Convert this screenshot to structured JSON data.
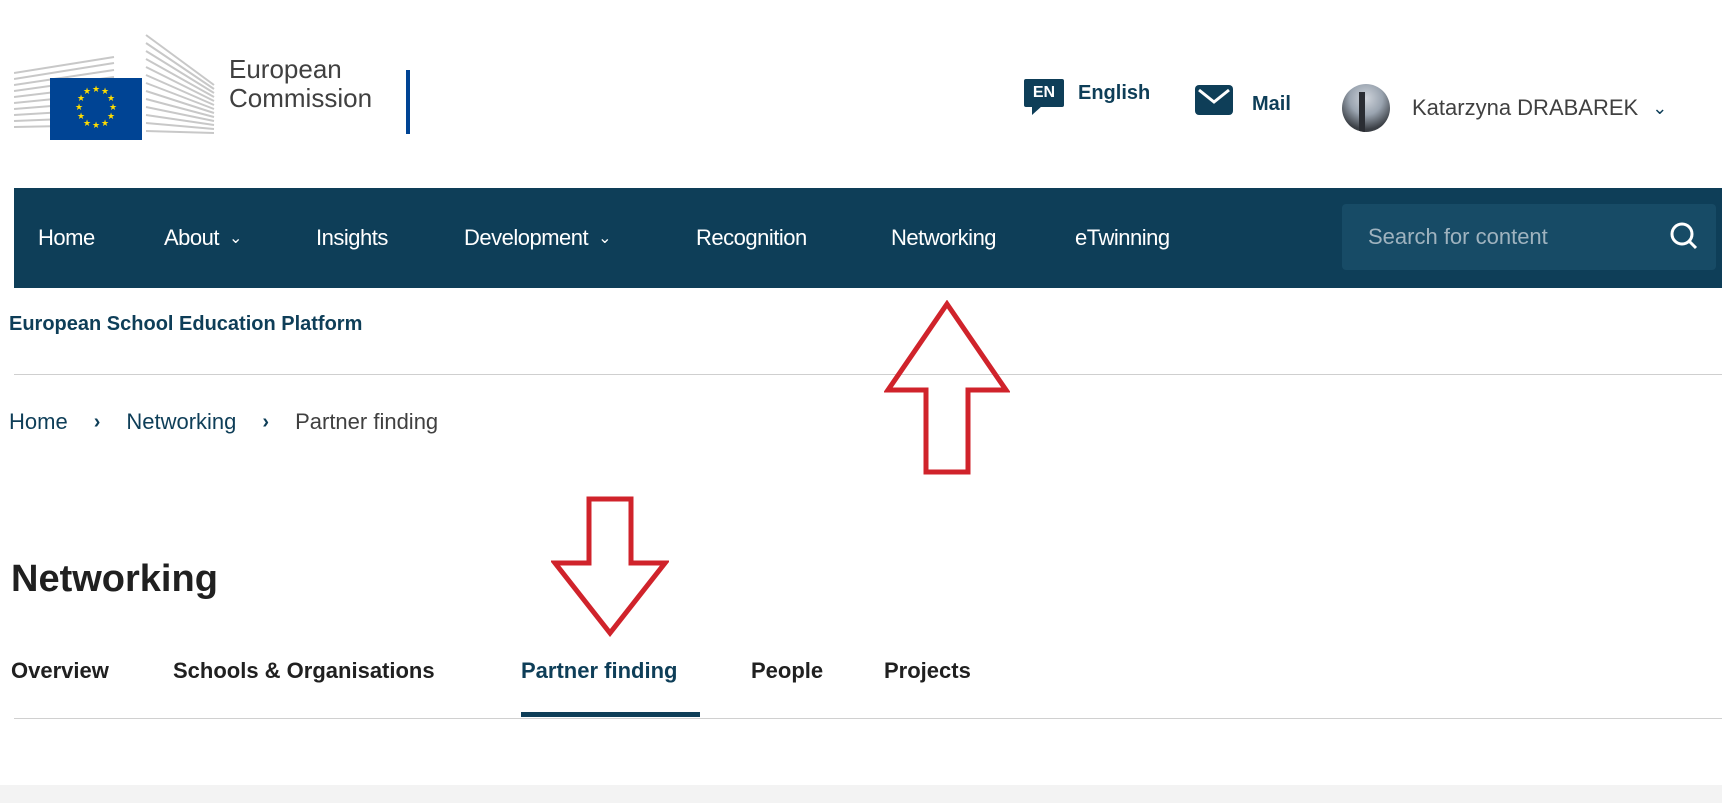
{
  "header": {
    "logo_text_line1": "European",
    "logo_text_line2": "Commission",
    "language_code": "EN",
    "language_label": "English",
    "mail_label": "Mail",
    "user_name": "Katarzyna DRABAREK"
  },
  "nav": {
    "items": [
      {
        "label": "Home"
      },
      {
        "label": "About",
        "dropdown": true
      },
      {
        "label": "Insights"
      },
      {
        "label": "Development",
        "dropdown": true
      },
      {
        "label": "Recognition"
      },
      {
        "label": "Networking"
      },
      {
        "label": "eTwinning"
      }
    ],
    "search_placeholder": "Search for content"
  },
  "platform_name": "European School Education Platform",
  "breadcrumb": {
    "items": [
      "Home",
      "Networking",
      "Partner finding"
    ],
    "separator": "›"
  },
  "page_title": "Networking",
  "tabs": {
    "items": [
      "Overview",
      "Schools & Organisations",
      "Partner finding",
      "People",
      "Projects"
    ],
    "active": "Partner finding"
  },
  "colors": {
    "nav_bg": "#0e3e58",
    "brand_blue": "#004494",
    "annotation_red": "#d0232b"
  },
  "annotations": [
    "arrow-up-to-networking-nav",
    "arrow-down-to-partner-finding-tab"
  ]
}
